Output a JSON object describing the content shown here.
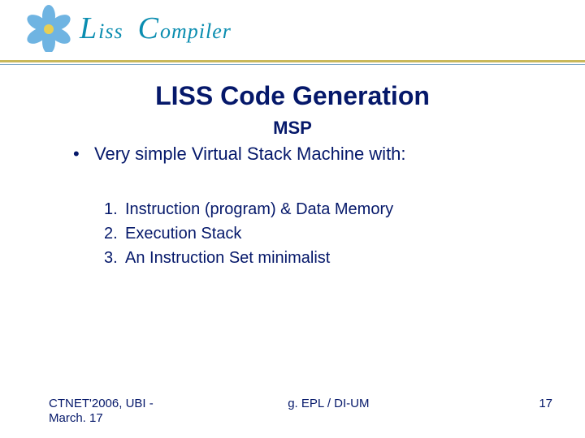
{
  "brand": {
    "word1_initial": "L",
    "word1_rest": "iss",
    "word2_initial": "C",
    "word2_rest": "ompiler"
  },
  "slide": {
    "title": "LISS Code Generation",
    "subtitle": "MSP",
    "bullet": "Very simple Virtual Stack Machine with:",
    "items": [
      "Instruction (program) & Data Memory",
      "Execution Stack",
      "An Instruction Set minimalist"
    ]
  },
  "footer": {
    "left_line1": "CTNET'2006, UBI -",
    "left_line2": "March. 17",
    "center": "g. EPL / DI-UM",
    "page": "17"
  }
}
